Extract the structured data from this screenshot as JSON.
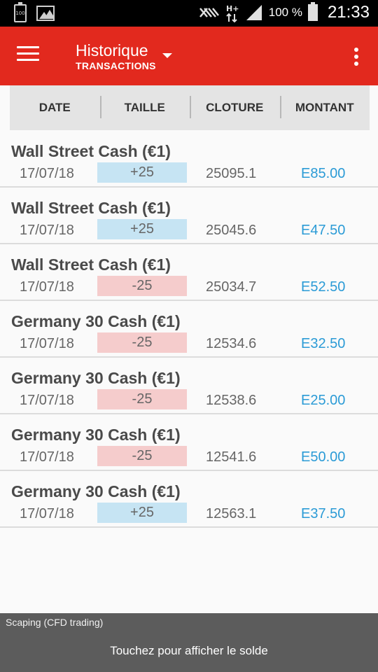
{
  "status_bar": {
    "battery_badge": "100",
    "battery_percent": "100 %",
    "time": "21:33",
    "network": "H+"
  },
  "app_bar": {
    "title": "Historique",
    "subtitle": "TRANSACTIONS"
  },
  "columns": [
    "DATE",
    "TAILLE",
    "CLOTURE",
    "MONTANT"
  ],
  "transactions": [
    {
      "instrument": "Wall Street Cash (€1)",
      "date": "17/07/18",
      "size": "+25",
      "direction": "pos",
      "close": "25095.1",
      "amount": "E85.00"
    },
    {
      "instrument": "Wall Street Cash (€1)",
      "date": "17/07/18",
      "size": "+25",
      "direction": "pos",
      "close": "25045.6",
      "amount": "E47.50"
    },
    {
      "instrument": "Wall Street Cash (€1)",
      "date": "17/07/18",
      "size": "-25",
      "direction": "neg",
      "close": "25034.7",
      "amount": "E52.50"
    },
    {
      "instrument": "Germany 30 Cash (€1)",
      "date": "17/07/18",
      "size": "-25",
      "direction": "neg",
      "close": "12534.6",
      "amount": "E32.50"
    },
    {
      "instrument": "Germany 30 Cash (€1)",
      "date": "17/07/18",
      "size": "-25",
      "direction": "neg",
      "close": "12538.6",
      "amount": "E25.00"
    },
    {
      "instrument": "Germany 30 Cash (€1)",
      "date": "17/07/18",
      "size": "-25",
      "direction": "neg",
      "close": "12541.6",
      "amount": "E50.00"
    },
    {
      "instrument": "Germany 30 Cash (€1)",
      "date": "17/07/18",
      "size": "+25",
      "direction": "pos",
      "close": "12563.1",
      "amount": "E37.50"
    }
  ],
  "bottom_bar": {
    "account_label": "Scaping (CFD trading)",
    "action_text": "Touchez pour afficher le solde"
  },
  "colors": {
    "app_bar": "#e2291e",
    "positive_size": "#c6e4f3",
    "negative_size": "#f5cccc",
    "amount": "#2b9bd6",
    "bottom_bar": "#5c5c5c"
  },
  "icons": {
    "status_left": [
      "battery-100-icon",
      "image-icon"
    ],
    "status_right": [
      "nfc-icon",
      "network-h-plus-icon",
      "signal-icon",
      "battery-icon"
    ],
    "app_bar": [
      "hamburger-menu-icon",
      "dropdown-arrow-icon",
      "overflow-menu-icon"
    ]
  }
}
